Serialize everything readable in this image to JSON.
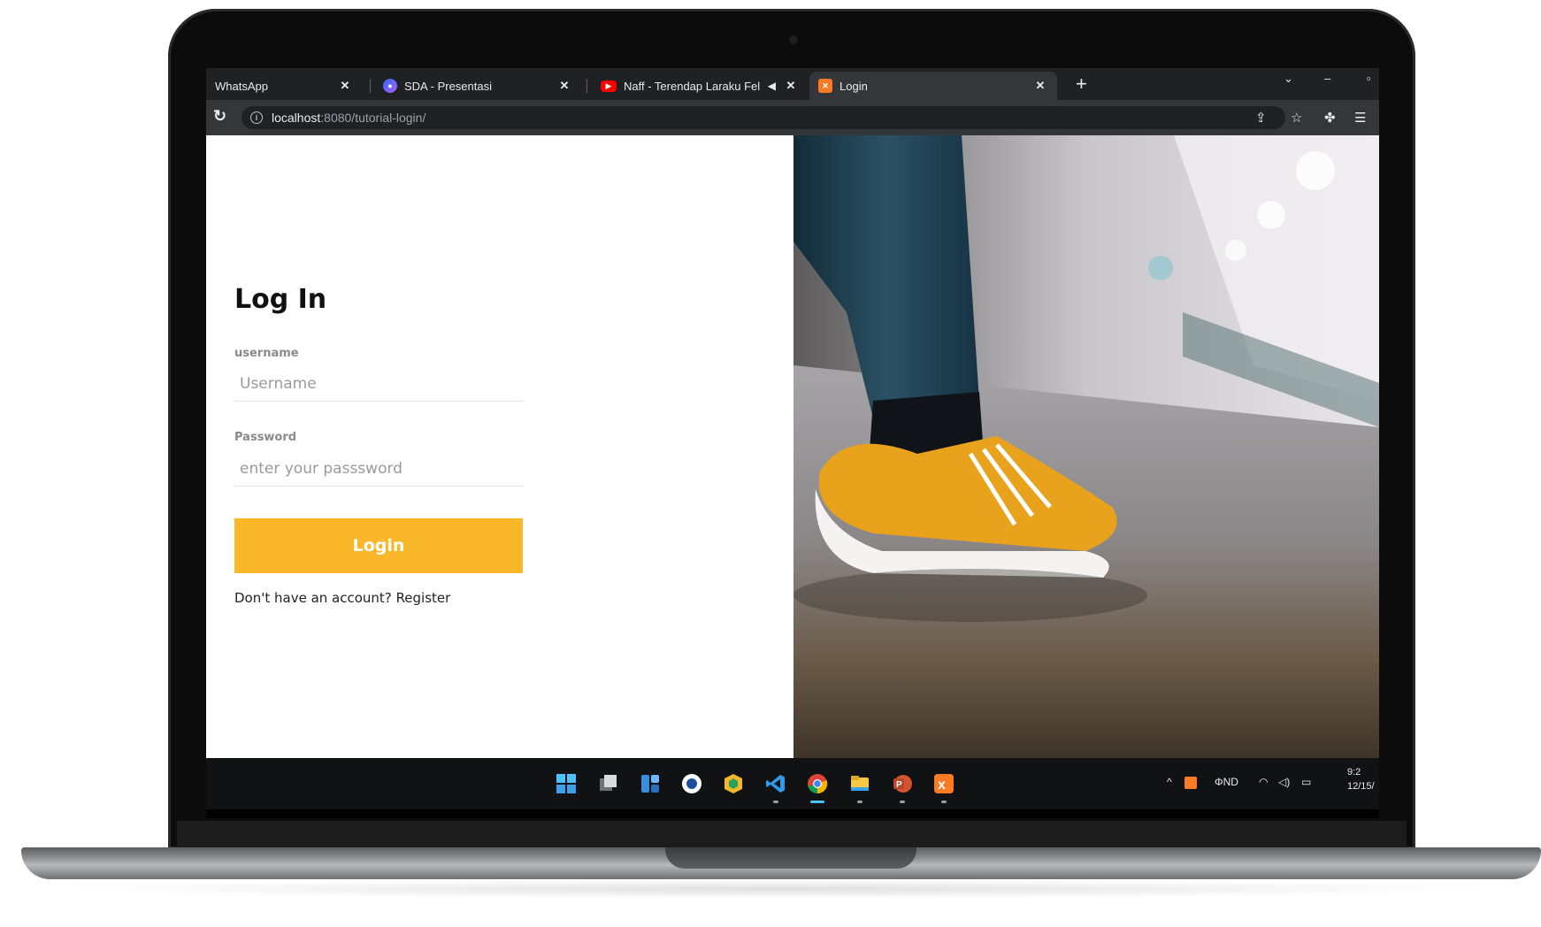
{
  "browser": {
    "tabs": [
      {
        "title": "WhatsApp",
        "icon": "whatsapp-icon"
      },
      {
        "title": "SDA - Presentasi",
        "icon": "chrome-canvas-icon"
      },
      {
        "title": "Naff - Terendap Laraku Felix",
        "icon": "youtube-icon"
      },
      {
        "title": "Login",
        "icon": "xampp-icon",
        "active": true
      }
    ],
    "new_tab": "+",
    "close": "✕",
    "url_host": "localhost",
    "url_path": ":8080/tutorial-login/"
  },
  "login": {
    "title": "Log In",
    "username_label": "username",
    "username_placeholder": "Username",
    "password_label": "Password",
    "password_placeholder": "enter your passsword",
    "button": "Login",
    "register_prompt": "Don't have an account?",
    "register_link": "Register"
  },
  "taskbar": {
    "apps": [
      "start",
      "task-view",
      "widgets",
      "app-circle",
      "app-hex",
      "vscode",
      "chrome",
      "file-explorer",
      "powerpoint",
      "xampp"
    ],
    "tray_lang": "ΦND",
    "clock_time": "9:2",
    "clock_date": "12/15/"
  },
  "colors": {
    "accent": "#fbb72a",
    "chrome_dark": "#202124",
    "chrome_toolbar": "#35363a"
  }
}
